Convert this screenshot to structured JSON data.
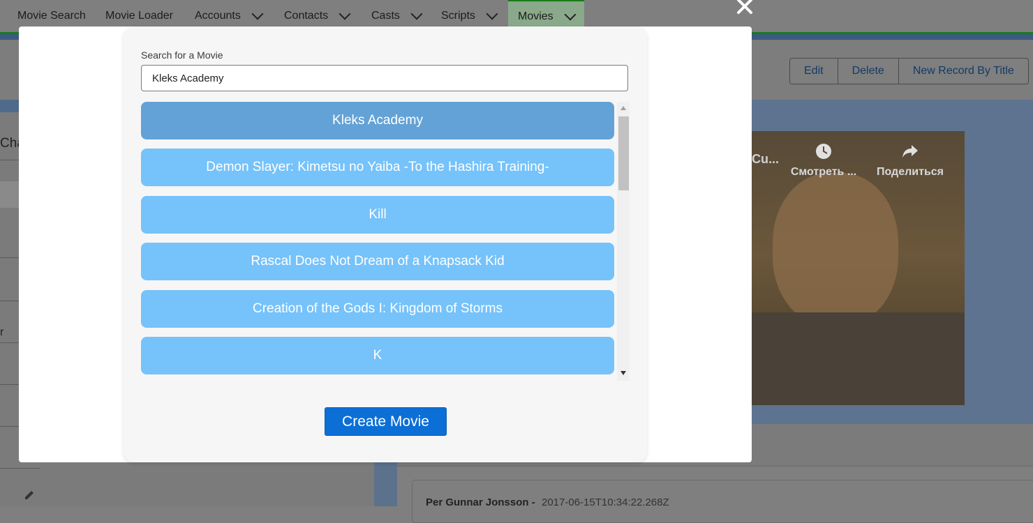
{
  "nav": {
    "items": [
      {
        "label": "Movie Search",
        "dropdown": false
      },
      {
        "label": "Movie Loader",
        "dropdown": false
      },
      {
        "label": "Accounts",
        "dropdown": true
      },
      {
        "label": "Contacts",
        "dropdown": true
      },
      {
        "label": "Casts",
        "dropdown": true
      },
      {
        "label": "Scripts",
        "dropdown": true
      },
      {
        "label": "Movies",
        "dropdown": true,
        "active": true
      }
    ]
  },
  "record_actions": {
    "edit": "Edit",
    "delete": "Delete",
    "new_by_title": "New Record By Title"
  },
  "left_panel": {
    "partial_label": "Cha",
    "partial_label_2": "r"
  },
  "video": {
    "title_partial": "Cu...",
    "watch_later": "Смотреть ...",
    "share": "Поделиться"
  },
  "comment": {
    "author": "Per Gunnar Jonsson",
    "separator": "-",
    "timestamp": "2017-06-15T10:34:22.268Z"
  },
  "modal": {
    "search_label": "Search for a Movie",
    "search_value": "Kleks Academy",
    "results": [
      {
        "title": "Kleks Academy",
        "selected": true
      },
      {
        "title": "Demon Slayer: Kimetsu no Yaiba -To the Hashira Training-",
        "selected": false
      },
      {
        "title": "Kill",
        "selected": false
      },
      {
        "title": "Rascal Does Not Dream of a Knapsack Kid",
        "selected": false
      },
      {
        "title": "Creation of the Gods I: Kingdom of Storms",
        "selected": false
      },
      {
        "title": "K",
        "selected": false
      }
    ],
    "create_button": "Create Movie"
  },
  "colors": {
    "result_bg": "#76c2fa",
    "result_selected_bg": "#63a2d6",
    "primary_button": "#0b6fd6",
    "nav_active_border": "#1a7a1a"
  }
}
